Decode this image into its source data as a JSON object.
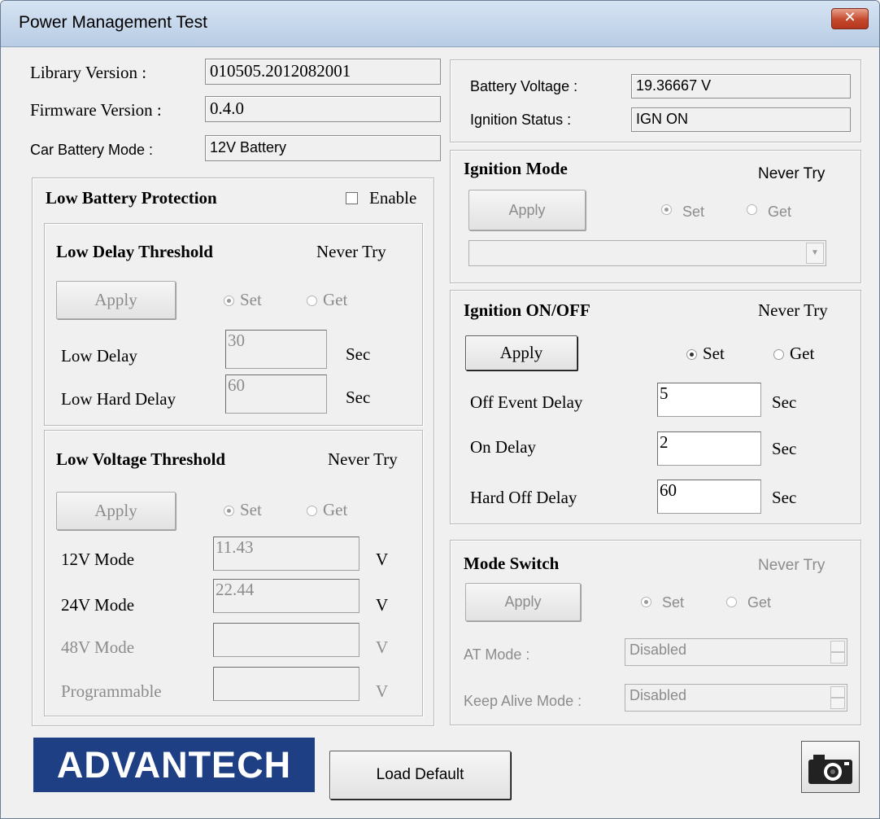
{
  "window": {
    "title": "Power Management Test",
    "close_glyph": "✕"
  },
  "info": {
    "library_version_label": "Library Version :",
    "library_version_value": "010505.2012082001",
    "firmware_version_label": "Firmware Version :",
    "firmware_version_value": "0.4.0",
    "car_battery_mode_label": "Car Battery Mode :",
    "car_battery_mode_value": "12V Battery"
  },
  "battery_status": {
    "battery_voltage_label": "Battery Voltage :",
    "battery_voltage_value": "19.36667 V",
    "ignition_status_label": "Ignition Status :",
    "ignition_status_value": "IGN ON"
  },
  "low_battery_protection": {
    "title": "Low Battery Protection",
    "enable_label": "Enable",
    "enable_checked": false,
    "low_delay_threshold": {
      "title": "Low Delay Threshold",
      "status": "Never Try",
      "apply_label": "Apply",
      "set_label": "Set",
      "get_label": "Get",
      "low_delay_label": "Low Delay",
      "low_delay_value": "30",
      "low_delay_unit": "Sec",
      "low_hard_delay_label": "Low Hard Delay",
      "low_hard_delay_value": "60",
      "low_hard_delay_unit": "Sec"
    },
    "low_voltage_threshold": {
      "title": "Low Voltage Threshold",
      "status": "Never Try",
      "apply_label": "Apply",
      "set_label": "Set",
      "get_label": "Get",
      "mode_12v_label": "12V Mode",
      "mode_12v_value": "11.43",
      "mode_24v_label": "24V Mode",
      "mode_24v_value": "22.44",
      "mode_48v_label": "48V Mode",
      "mode_48v_value": "",
      "programmable_label": "Programmable",
      "programmable_value": "",
      "unit": "V"
    }
  },
  "ignition_mode": {
    "title": "Ignition Mode",
    "status": "Never Try",
    "apply_label": "Apply",
    "set_label": "Set",
    "get_label": "Get",
    "combo_value": ""
  },
  "ignition_onoff": {
    "title": "Ignition ON/OFF",
    "status": "Never Try",
    "apply_label": "Apply",
    "set_label": "Set",
    "get_label": "Get",
    "off_event_delay_label": "Off Event Delay",
    "off_event_delay_value": "5",
    "on_delay_label": "On Delay",
    "on_delay_value": "2",
    "hard_off_delay_label": "Hard Off Delay",
    "hard_off_delay_value": "60",
    "unit": "Sec"
  },
  "mode_switch": {
    "title": "Mode Switch",
    "status": "Never Try",
    "apply_label": "Apply",
    "set_label": "Set",
    "get_label": "Get",
    "at_mode_label": "AT Mode :",
    "at_mode_value": "Disabled",
    "keep_alive_label": "Keep Alive Mode :",
    "keep_alive_value": "Disabled"
  },
  "footer": {
    "logo_text": "ADVANTECH",
    "load_default_label": "Load Default",
    "camera_icon": "camera-icon"
  }
}
